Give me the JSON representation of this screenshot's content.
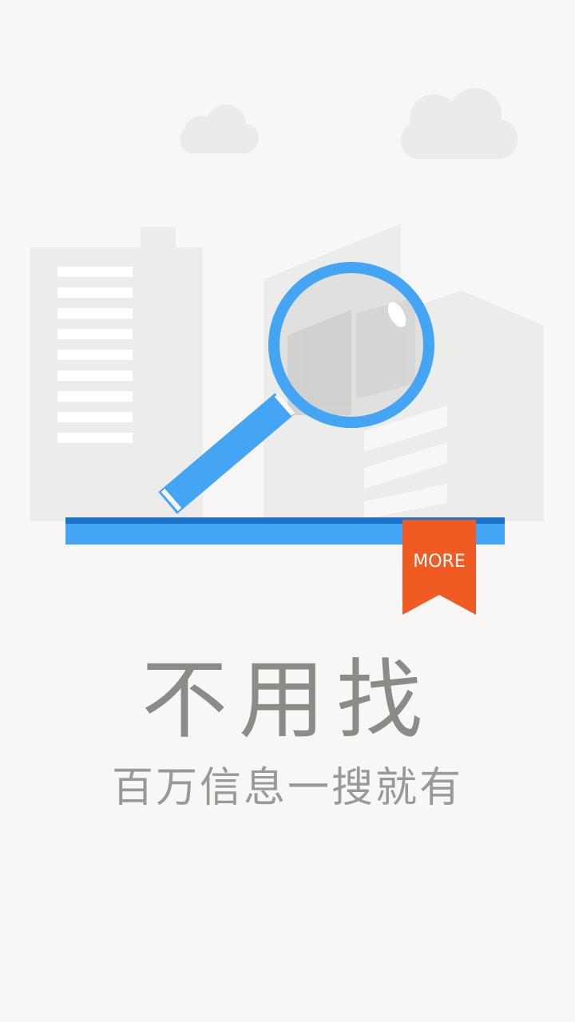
{
  "badge": {
    "label": "MORE"
  },
  "headline": "不用找",
  "tagline": "百万信息一搜就有",
  "colors": {
    "background": "#f8f7f5",
    "buildings": "#ececeb",
    "clouds": "#ebebea",
    "accent_blue": "#45a5f5",
    "shelf_dark": "#1a73c8",
    "ribbon": "#f05a23",
    "text": "#8c8b88"
  },
  "icons": [
    "magnifier-icon",
    "bookmark-ribbon"
  ]
}
